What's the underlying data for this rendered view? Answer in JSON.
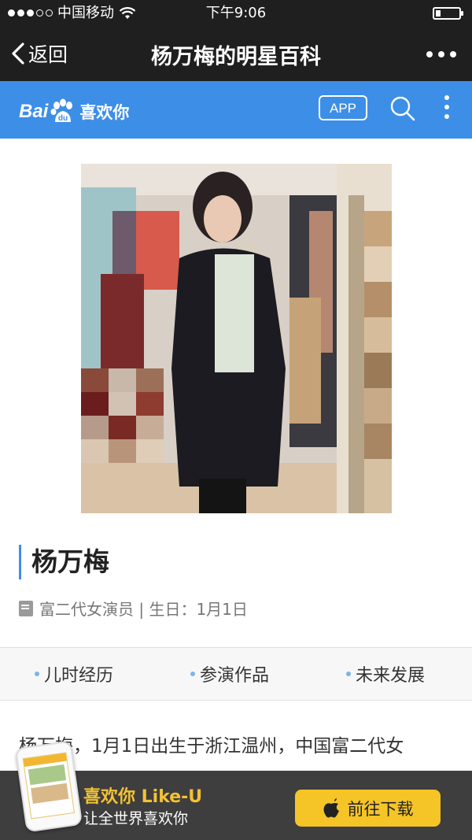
{
  "status_bar": {
    "carrier": "中国移动",
    "time": "下午9:06"
  },
  "nav": {
    "back_label": "返回",
    "title": "杨万梅的明星百科"
  },
  "baidu_header": {
    "logo_text": "Bai",
    "logo_paw_text": "du",
    "logo_cn": "喜欢你",
    "app_button": "APP",
    "accent_color": "#3d8ee7"
  },
  "profile": {
    "name": "杨万梅",
    "subtitle": "富二代女演员 | 生日：1月1日"
  },
  "tabs": [
    {
      "label": "儿时经历"
    },
    {
      "label": "参演作品"
    },
    {
      "label": "未来发展"
    }
  ],
  "intro_text": "杨万梅，1月1日出生于浙江温州，中国富二代女",
  "banner": {
    "brand_title": "喜欢你 Like-U",
    "brand_slogan": "让全世界喜欢你",
    "download_label": "前往下载",
    "button_color": "#f5c427"
  }
}
